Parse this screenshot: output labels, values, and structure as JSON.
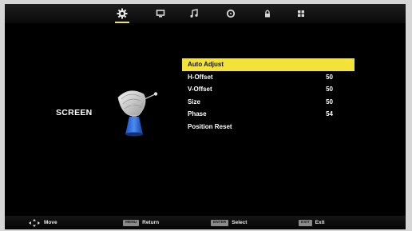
{
  "tabs": [
    {
      "icon": "gear-icon",
      "active": true
    },
    {
      "icon": "monitor-icon",
      "active": false
    },
    {
      "icon": "music-note-icon",
      "active": false
    },
    {
      "icon": "clock-icon",
      "active": false
    },
    {
      "icon": "lock-icon",
      "active": false
    },
    {
      "icon": "grid-icon",
      "active": false
    }
  ],
  "page": {
    "title": "SCREEN",
    "illustration": "satellite-dish-icon"
  },
  "menu": {
    "items": [
      {
        "label": "Auto Adjust",
        "value": "",
        "selected": true
      },
      {
        "label": "H-Offset",
        "value": "50",
        "selected": false
      },
      {
        "label": "V-Offset",
        "value": "50",
        "selected": false
      },
      {
        "label": "Size",
        "value": "50",
        "selected": false
      },
      {
        "label": "Phase",
        "value": "54",
        "selected": false
      },
      {
        "label": "Position Reset",
        "value": "",
        "selected": false
      }
    ]
  },
  "help": {
    "move_label": "Move",
    "return_key": "MENU",
    "return_label": "Return",
    "select_key": "ENTER",
    "select_label": "Select",
    "exit_key": "EXIT",
    "exit_label": "Exit"
  },
  "colors": {
    "highlight": "#f2e23a",
    "background": "#000000",
    "text": "#ffffff",
    "key_badge": "#8a8a8a"
  }
}
